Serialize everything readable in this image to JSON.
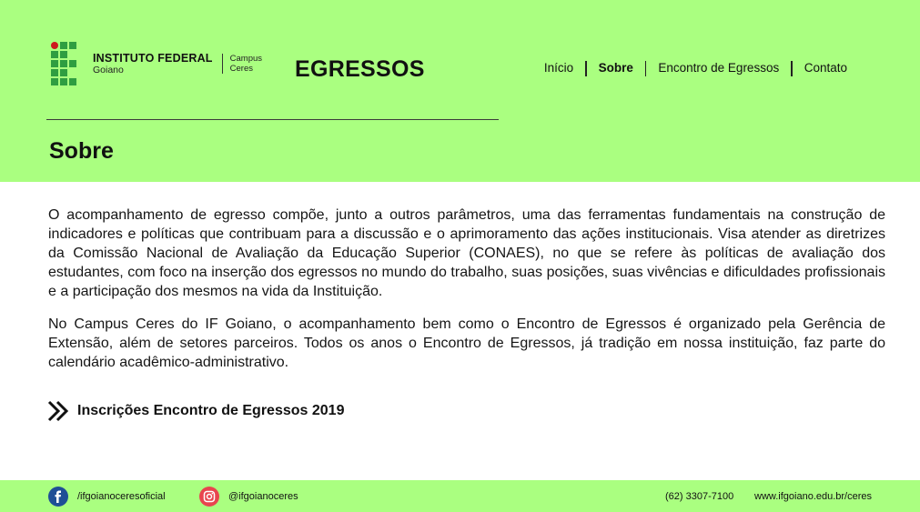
{
  "logo": {
    "title": "INSTITUTO FEDERAL",
    "subtitle": "Goiano",
    "campus_line1": "Campus",
    "campus_line2": "Ceres",
    "brand_green": "#2f9e41",
    "brand_red": "#cd191e"
  },
  "header": {
    "site_title": "EGRESSOS",
    "background": "#aaff80"
  },
  "nav": {
    "items": [
      {
        "label": "Início",
        "active": false
      },
      {
        "label": "Sobre",
        "active": true
      },
      {
        "label": "Encontro de Egressos",
        "active": false
      },
      {
        "label": "Contato",
        "active": false
      }
    ]
  },
  "page": {
    "title": "Sobre",
    "paragraphs": [
      "O acompanhamento de egresso compõe, junto a outros parâmetros, uma das ferramentas fundamentais na construção de indicadores e políticas que contribuam para a discussão e o aprimoramento das ações institucionais. Visa atender as diretrizes da Comissão Nacional de Avaliação da Educação Superior (CONAES), no que se refere às políticas de avaliação dos estudantes, com foco na inserção dos egressos no mundo do trabalho,  suas posições,  suas vivências e dificuldades profissionais e a participação dos mesmos na vida da Instituição.",
      "No Campus Ceres do IF Goiano,  o acompanhamento bem como o Encontro de Egressos é organizado pela Gerência de Extensão, além de setores parceiros. Todos os anos o Encontro de Egressos,  já tradição em nossa instituição,  faz parte do calendário acadêmico-administrativo."
    ],
    "link_label": "Inscrições Encontro de Egressos 2019",
    "link_icon": "double-chevron-right-icon"
  },
  "footer": {
    "facebook": {
      "icon": "facebook-icon",
      "label": "/ifgoianoceresoficial"
    },
    "instagram": {
      "icon": "instagram-icon",
      "label": "@ifgoianoceres"
    },
    "phone": "(62) 3307-7100",
    "website": "www.ifgoiano.edu.br/ceres"
  }
}
